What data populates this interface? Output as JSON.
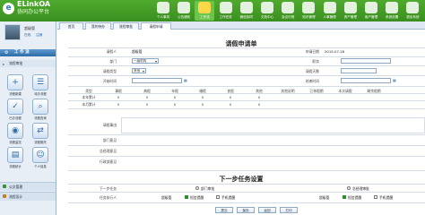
{
  "header": {
    "logo_mark": "e",
    "app_title": "ELinkOA",
    "app_subtitle": "协同办公平台",
    "nav_items": [
      {
        "label": "个人事务",
        "icon": "person-icon"
      },
      {
        "label": "公告通知",
        "icon": "notice-icon"
      },
      {
        "label": "工作流",
        "icon": "workflow-icon"
      },
      {
        "label": "工作任务",
        "icon": "task-icon"
      },
      {
        "label": "微信协同",
        "icon": "wechat-icon"
      },
      {
        "label": "文档中心",
        "icon": "document-icon"
      },
      {
        "label": "会议行程",
        "icon": "calendar-icon"
      },
      {
        "label": "知识管理",
        "icon": "knowledge-icon"
      },
      {
        "label": "人事管理",
        "icon": "hr-icon"
      },
      {
        "label": "资产管理",
        "icon": "asset-icon"
      },
      {
        "label": "客户管理",
        "icon": "customer-icon"
      },
      {
        "label": "系统设置",
        "icon": "settings-icon"
      },
      {
        "label": "退出系统",
        "icon": "exit-icon"
      }
    ],
    "active_nav": 2
  },
  "sidebar": {
    "user_name": "超级管",
    "user_links": [
      "在线",
      "注销"
    ],
    "panel_title": "工 作 流",
    "section_label": "流程审批",
    "apps": [
      {
        "label": "流程新建",
        "glyph": "+"
      },
      {
        "label": "待办流程",
        "glyph": "☰"
      },
      {
        "label": "已办流程",
        "glyph": "✓"
      },
      {
        "label": "流程查询",
        "glyph": "⌕"
      },
      {
        "label": "流程监控",
        "glyph": "◉"
      },
      {
        "label": "流程委托",
        "glyph": "⇄"
      },
      {
        "label": "流程统计",
        "glyph": "▤"
      },
      {
        "label": "个人信息",
        "glyph": "☺"
      }
    ],
    "bottom_items": [
      "公文管理",
      "流程设计"
    ]
  },
  "tabs": [
    {
      "label": "首页"
    },
    {
      "label": "我的待办"
    },
    {
      "label": "流程审批"
    },
    {
      "label": "请假申请"
    }
  ],
  "active_tab": 3,
  "form": {
    "title": "请假申请单",
    "applicant_label": "请假人",
    "applicant_value": "超级管",
    "apply_date_label": "申请日期",
    "apply_date_value": "2015-07-28",
    "dept_label": "部门",
    "dept_value": "一级机构",
    "position_label": "职务",
    "position_value": "",
    "leave_type_label": "请假类型",
    "leave_type_value": "其他",
    "leave_days_label": "请假天数",
    "leave_days_value": "",
    "start_label": "开始时间",
    "end_label": "结束时间",
    "table_headers": [
      "类型",
      "事假",
      "病假",
      "年假",
      "婚假",
      "丧假",
      "其他",
      "其他说明",
      "已休假期",
      "本次请假",
      "剩余假期"
    ],
    "table_rows": [
      {
        "label": "本年累计",
        "values": [
          "0",
          "0",
          "0",
          "0",
          "0",
          "0"
        ]
      },
      {
        "label": "本月累计",
        "values": [
          "0",
          "0",
          "0",
          "0",
          "0",
          "0"
        ]
      }
    ],
    "reason_label": "请假事由",
    "opinion_rows": [
      "部门意见",
      "总经理意见",
      "行政部意见"
    ]
  },
  "next_task": {
    "title": "下一步任务设置",
    "task_label": "下一步任务",
    "task_options": [
      "部门审批",
      "总经理审批"
    ],
    "handler_label": "任务执行人",
    "handler_left_name": "超级管",
    "handler_right_name": "超级管",
    "sms_label": "短信提醒",
    "mobile_label": "手机提醒",
    "buttons": [
      "提交",
      "保存",
      "返回",
      "打印"
    ]
  }
}
